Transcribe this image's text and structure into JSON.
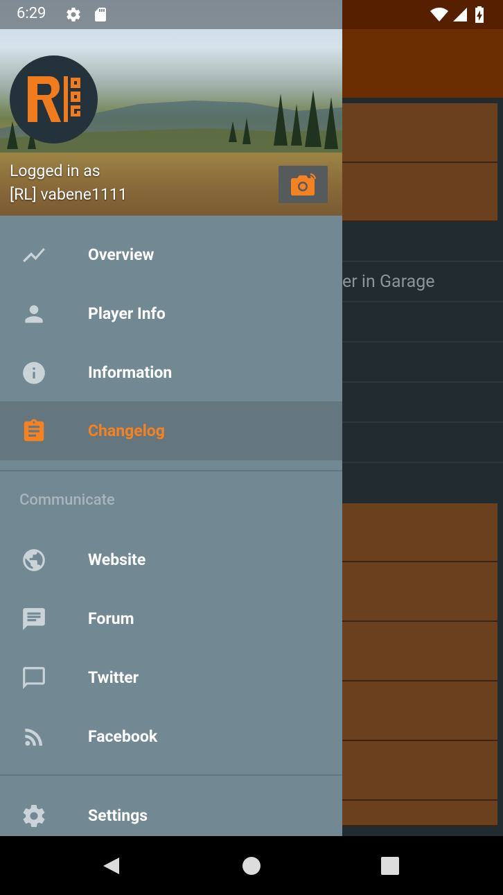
{
  "status_bar": {
    "time": "6:29",
    "icons": [
      "settings-icon",
      "sd-card-icon",
      "wifi-icon",
      "signal-icon",
      "battery-charging-icon"
    ]
  },
  "background_app": {
    "visible_text": "er in Garage"
  },
  "drawer": {
    "header": {
      "logo": "RL RPG logo",
      "logged_in_label": "Logged in as",
      "user_name": "[RL] vabene1111",
      "camera_icon": "camera-icon"
    },
    "items": [
      {
        "label": "Overview",
        "icon": "trending-icon",
        "selected": false
      },
      {
        "label": "Player Info",
        "icon": "person-icon",
        "selected": false
      },
      {
        "label": "Information",
        "icon": "info-icon",
        "selected": false
      },
      {
        "label": "Changelog",
        "icon": "clipboard-icon",
        "selected": true
      }
    ],
    "section_header": "Communicate",
    "communicate_items": [
      {
        "label": "Website",
        "icon": "globe-icon"
      },
      {
        "label": "Forum",
        "icon": "forum-icon"
      },
      {
        "label": "Twitter",
        "icon": "chat-bubble-icon"
      },
      {
        "label": "Facebook",
        "icon": "rss-icon"
      }
    ],
    "settings_item": {
      "label": "Settings",
      "icon": "gear-icon"
    }
  },
  "colors": {
    "drawer_bg": "#728893",
    "selected_bg": "#64777f",
    "accent_orange": "#f58220",
    "icon_gray": "#c9d3d8",
    "background_brown": "#6a401e",
    "appbar_brown": "#6a2e00"
  },
  "nav_bar": {
    "buttons": [
      "back-button",
      "home-button",
      "recents-button"
    ]
  }
}
